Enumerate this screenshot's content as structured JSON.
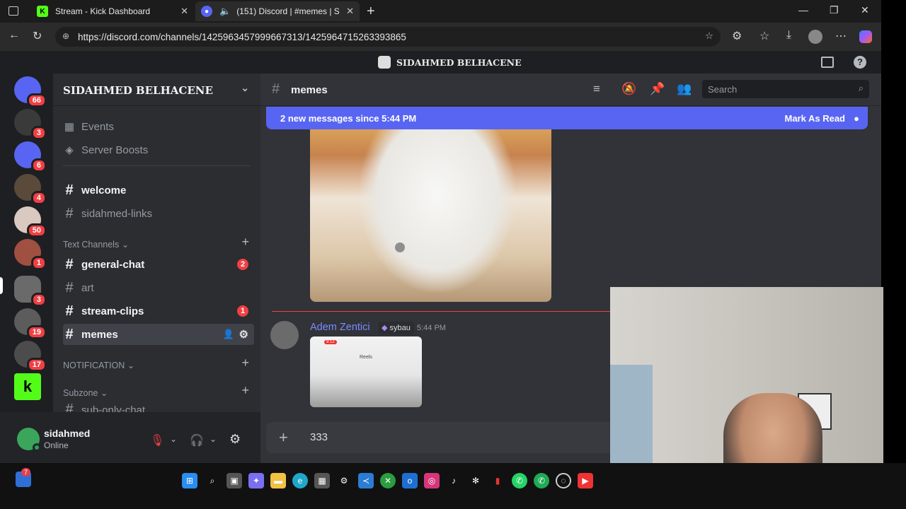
{
  "browser": {
    "tabs": [
      {
        "title": "Stream - Kick Dashboard",
        "icon": "kick-icon"
      },
      {
        "title": "(151) Discord | #memes | SII",
        "icon": "discord-icon"
      }
    ],
    "url": "https://discord.com/channels/1425963457999667313/1425964715263393865"
  },
  "discord": {
    "window_title": "SIDAHMED BELHACENE",
    "guilds": [
      {
        "name": "home",
        "badge": "66"
      },
      {
        "name": "server-1",
        "badge": "3"
      },
      {
        "name": "server-2",
        "badge": "6"
      },
      {
        "name": "server-3",
        "badge": "4"
      },
      {
        "name": "server-4",
        "badge": "50"
      },
      {
        "name": "server-5",
        "badge": "1"
      },
      {
        "name": "server-6",
        "badge": "3"
      },
      {
        "name": "server-7",
        "badge": "19"
      },
      {
        "name": "server-8",
        "badge": "17"
      },
      {
        "name": "kick-server",
        "badge": ""
      }
    ],
    "server_name": "SIDAHMED BELHACENE",
    "top_items": [
      "Events",
      "Server Boosts"
    ],
    "channels_top": [
      {
        "name": "welcome",
        "bold": true
      },
      {
        "name": "sidahmed-links",
        "bold": false
      }
    ],
    "category_text": "Text Channels",
    "text_channels": [
      {
        "name": "general-chat",
        "bold": true,
        "badge": "2"
      },
      {
        "name": "art",
        "bold": false,
        "badge": ""
      },
      {
        "name": "stream-clips",
        "bold": true,
        "badge": "1"
      },
      {
        "name": "memes",
        "bold": true,
        "badge": ""
      }
    ],
    "category_notification": "NOTIFICATION",
    "category_subzone": "Subzone",
    "subzone_channel": "sub-only-chat",
    "user": {
      "name": "sidahmed",
      "status": "Online"
    },
    "chat": {
      "channel": "memes",
      "search_placeholder": "Search",
      "new_messages": "2 new messages since 5:44 PM",
      "mark_as_read": "Mark As Read",
      "message": {
        "author": "Adem Zentici",
        "tag": "sybau",
        "time": "5:44 PM",
        "phone_time": "9:12",
        "phone_label": "Reels"
      },
      "composer_text": "333"
    }
  },
  "taskbar": {
    "notification_badge": "7"
  }
}
